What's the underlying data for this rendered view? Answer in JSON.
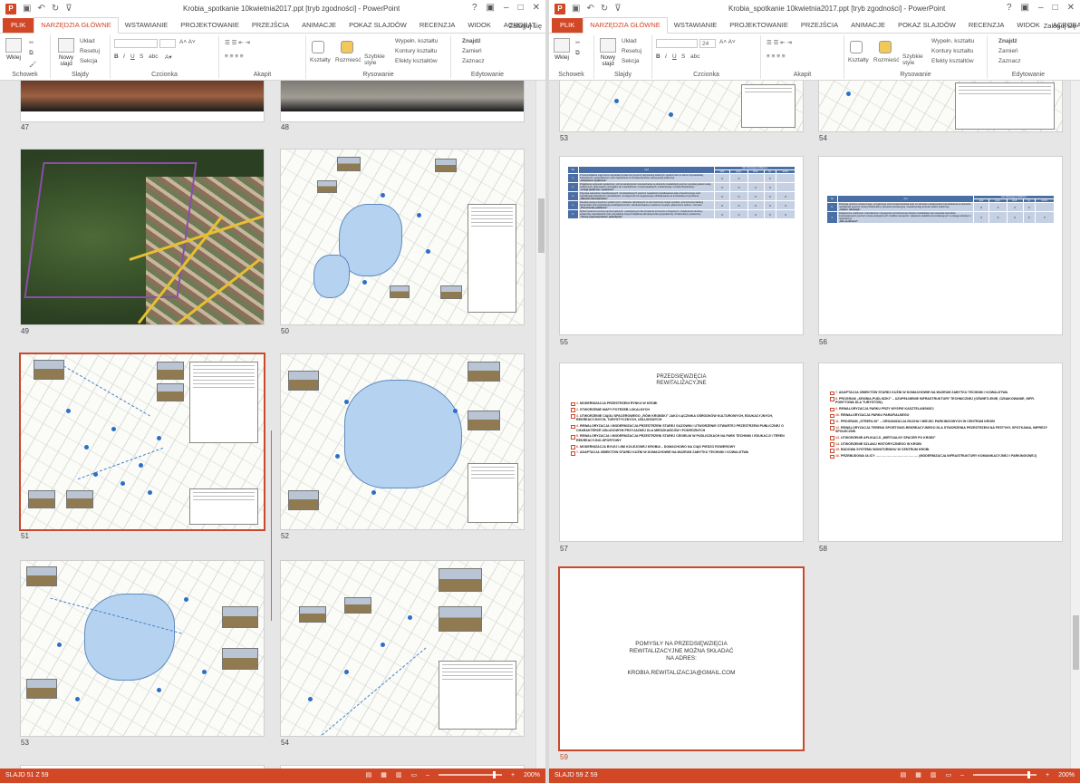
{
  "app": {
    "left_title": "Krobia_spotkanie 10kwietnia2017.ppt [tryb zgodności] - PowerPoint",
    "right_title": "Krobia_spotkanie 10kwietnia2017.ppt [tryb zgodności] - PowerPoint",
    "window_controls": [
      "?",
      "▣",
      "–",
      "□",
      "✕"
    ],
    "sign_in": "Zaloguj się"
  },
  "tabs": [
    "PLIK",
    "NARZĘDZIA GŁÓWNE",
    "WSTAWIANIE",
    "PROJEKTOWANIE",
    "PRZEJŚCIA",
    "ANIMACJE",
    "POKAZ SLAJDÓW",
    "RECENZJA",
    "WIDOK",
    "ACROBAT"
  ],
  "ribbon": {
    "paste": "Wklej",
    "new_slide": "Nowy slajd",
    "layout": "Układ",
    "reset": "Resetuj",
    "section": "Sekcja",
    "font_size": "24",
    "shapes": "Kształty",
    "arrange": "Rozmieść",
    "quick_styles": "Szybkie style",
    "shape_fill": "Wypełn. kształtu",
    "shape_outline": "Kontury kształtu",
    "shape_effects": "Efekty kształtów",
    "find": "Znajdź",
    "replace": "Zamień",
    "select": "Zaznacz",
    "groups": [
      "Schowek",
      "Slajdy",
      "Czcionka",
      "Akapit",
      "Rysowanie",
      "Edytowanie"
    ]
  },
  "left_slides": [
    "47",
    "48",
    "49",
    "50",
    "51",
    "52",
    "53",
    "54"
  ],
  "right_slides": [
    "53",
    "54",
    "55",
    "56",
    "57",
    "58",
    "59"
  ],
  "table55": {
    "header_nr": "Nr.",
    "header_cel": "Cel",
    "header_group": "Cel zdrowego problemu:",
    "subheaders": [
      "społ.",
      "gosp.",
      "środ.",
      "f-p.",
      "techn."
    ],
    "rows": [
      {
        "nr": "1.",
        "text": "Przeciwdziałanie zagrożeniu degradacji społecznej poprzez aktywizację lokalnych społeczności w sferze obywatelskiej, kulturalnych i gospodarczym oraz zapewnienie im bezpieczeństwa i partycypacji publicznej",
        "label": "„Aktywność społeczna”",
        "marks": [
          "X",
          "X",
          "",
          "X",
          ""
        ]
      },
      {
        "nr": "2.",
        "text": "Pogłębienie spójności społecznej i wzrost atrakcyjności zamieszkania na obszarze rewitalizacji poprzez wysokiej jakości usług publicznych, skierowanie szczególne do mieszkańców i rozpoznawalnych; modernizacja i rozwój infrastruktury",
        "label": "„Usługi publiczne i społeczne”",
        "marks": [
          "X",
          "X",
          "X",
          "X",
          ""
        ]
      },
      {
        "nr": "3.",
        "text": "Poprawa warunków mieszkaniowych i środowiskowych poprzez zasadnicze kształtowanie ładu przestrzennego oraz rewitalizacja kulturalnych mieszkańców; zmniejszenie ich negatywnego oddziaływania na środowisko przyrodnicze",
        "label": "„Warunki mieszkaniowe”",
        "marks": [
          "X",
          "X",
          "X",
          "X",
          "X"
        ]
      },
      {
        "nr": "4.",
        "text": "Rewaloryzacja przestrzeni publicznych i obiektów zabytkowych w celu tworzenia miejsc spotkań, wzmocnienia lokalnej tożsamości oraz pobudzania przedsiębiorczości i zainteresowania w sektorze turystyki, gastronomii, kultury i rozrywki",
        "label": "„Przestrzenie publiczne”",
        "marks": [
          "X",
          "X",
          "X",
          "X",
          "X"
        ]
      },
      {
        "nr": "5.",
        "text": "Wykorzystanie terenów poprzemysłowych i pokolejowych dla ożywienia procesów rozwojowych, zwiększenia struktury społecznej mieszkańców oraz pozyskania nowych lokalizacji dla aktywności gospodarczej i infrastruktury społecznej",
        "label": "„Tereny poprzemysłowe i pokolejowe”",
        "marks": [
          "X",
          "X",
          "X",
          "X",
          "X"
        ]
      }
    ]
  },
  "table56": {
    "header_nr": "Nr.",
    "header_cel": "Cel",
    "header_group": "Cel zdrowego problemu:",
    "subheaders": [
      "społ.",
      "gosp.",
      "środ.",
      "f-p.",
      "techn."
    ],
    "rows": [
      {
        "nr": "6.",
        "text": "Poprawa poziomu estetycznego, przyjaznego oraz bezpieczeństwa wraz ze wzrostem atrakcyjności zamieszkania na obszarze rewitalizacji poprzez rozwój infrastruktury sportowo-rekreacyjnej i rewaloryzację terenów zieleni publicznej",
        "label": "„Zieleń i rekreacja”",
        "marks": [
          "X",
          "X",
          "X",
          "X",
          ""
        ]
      },
      {
        "nr": "7.",
        "text": "Zwiększenie mobilności mieszkańców i dostępności przestrzennej obszaru rewitalizacji oraz poprawa warunków środowiskowych poprzez rozwój ekologicznych środków transportu i ułatwienie układów komunikacyjnych w zasięgu lokalnym i regionalnym",
        "label": "„Eko-mobilność”",
        "marks": [
          "X",
          "X",
          "X",
          "X",
          "X"
        ]
      }
    ]
  },
  "slide57": {
    "title": "PRZEDSIĘWZIĘCIA REWITALIZACYJNE",
    "items": [
      {
        "n": "1.",
        "t": "MODERNIZACJA PRZESTRZENI RYNKU W KROBI"
      },
      {
        "n": "2.",
        "t": "STWORZENIE MAPY POTRZEB LOKALNYCH"
      },
      {
        "n": "3.",
        "t": "UTWORZENIE CIĄGU SPACEROWEGO „RÓW KROBSKI” JAKO ŁĄCZNIKA OŚRODKÓW KULTUROWYCH, EDUKACYJNYCH, REKREACYJNYCH, TURYSTYCZNYCH, USŁUGOWYCH"
      },
      {
        "n": "4.",
        "t": "REWALORYZACJA I MODERNIZACJA PRZESTRZENI STAREJ GAZOWNI I UTWORZENIE OTWARTEJ PRZESTRZENI PUBLICZNEJ O CHARAKTERZE USŁUGOWYM PRZYJAZNEJ DLA MIESZKAŃCÓW I PODRÓŻNYCH"
      },
      {
        "n": "5.",
        "t": "REWALORYZACJA I MODERNIZACJA PRZESTRZENI STAREJ CEGIELNI W PUDLISZKACH NA PARK TECHNIKI I EDUKACJI I TEREN REKREACYJNO-SPORTOWY"
      },
      {
        "n": "6.",
        "t": "MODERNIZACJA BYŁEJ LINII KOLEJOWEJ KROBIA – DOMACHOWO NA CIĄG PIESZO ROWEROWY"
      },
      {
        "n": "7.",
        "t": "ADAPTACJA OBIEKTÓW STAREJ KUŹNI W DOMACHOWIE NA MUZEUM ZABYTKU TECHNIKI I KOWALSTWA"
      }
    ]
  },
  "slide58": {
    "items": [
      {
        "n": "7.",
        "t": "ADAPTACJA OBIEKTÓW STAREJ KUŹNI W DOMACHOWIE NA MUZEUM ZABYTKU TECHNIKI I KOWALSTWA"
      },
      {
        "n": "8.",
        "t": "PROGRAM „KROBIA-PUDLISZKI” – UZUPEŁNIENIE INFRASTRUKTURY TECHNICZNEJ (OŚWIETLENIE, OZNAKOWANIE, INFR. POBYTOWA DLA TURYSTÓW)."
      },
      {
        "n": "9.",
        "t": "REWALORYZACJA PARKU PRZY WYSPIE KASZTELAŃSKIEJ"
      },
      {
        "n": "10.",
        "t": "REWALORYZACJA PARKU PARAFIALNEGO"
      },
      {
        "n": "11.",
        "t": "PROGRAM „STREFA 30” – ORGANIZACJA RUCHU I MIEJSC PARKINGOWYCH W CENTRUM KROBI"
      },
      {
        "n": "12.",
        "t": "REWALORYZACJA TERENU SPORTOWO-REKREACYJNEGO DLA STWORZENIA PRZESTRZENI NA FESTYNY, SPOTKANIA, IMPREZY SPOŁECZNE."
      },
      {
        "n": "13.",
        "t": "UTWORZENIE APLIKACJI „WIRTUALNY SPACER PO KROBI”"
      },
      {
        "n": "14.",
        "t": "UTWORZENIE SZLAKU HISTORYCZNEGO W KROBI"
      },
      {
        "n": "15.",
        "t": "BUDOWA SYSTEMU MONITORINGU W CENTRUM KROBI"
      },
      {
        "n": "16.",
        "t": "PRZEBUDOWA ULICY ………………………………… (MODERNIZACJA INFRASTRUKTURY KOMUNIKACYJNEJ I PARKINGOWEJ)"
      }
    ]
  },
  "slide59": {
    "lines": [
      "POMYSŁY NA PRZEDSIĘWZIĘCIA",
      "REWITALIZACYJNE MOŻNA SKŁADAĆ",
      "NA ADRES:",
      "",
      "KROBIA.REWITALIZACJA@GMAIL.COM"
    ]
  },
  "status": {
    "left": "SLAJD 51 Z 59",
    "right": "SLAJD 59 Z 59",
    "zoom": "200%"
  },
  "colors": {
    "accent": "#d24726",
    "table_header": "#4a6fa5",
    "table_cell": "#c5d0e3"
  }
}
